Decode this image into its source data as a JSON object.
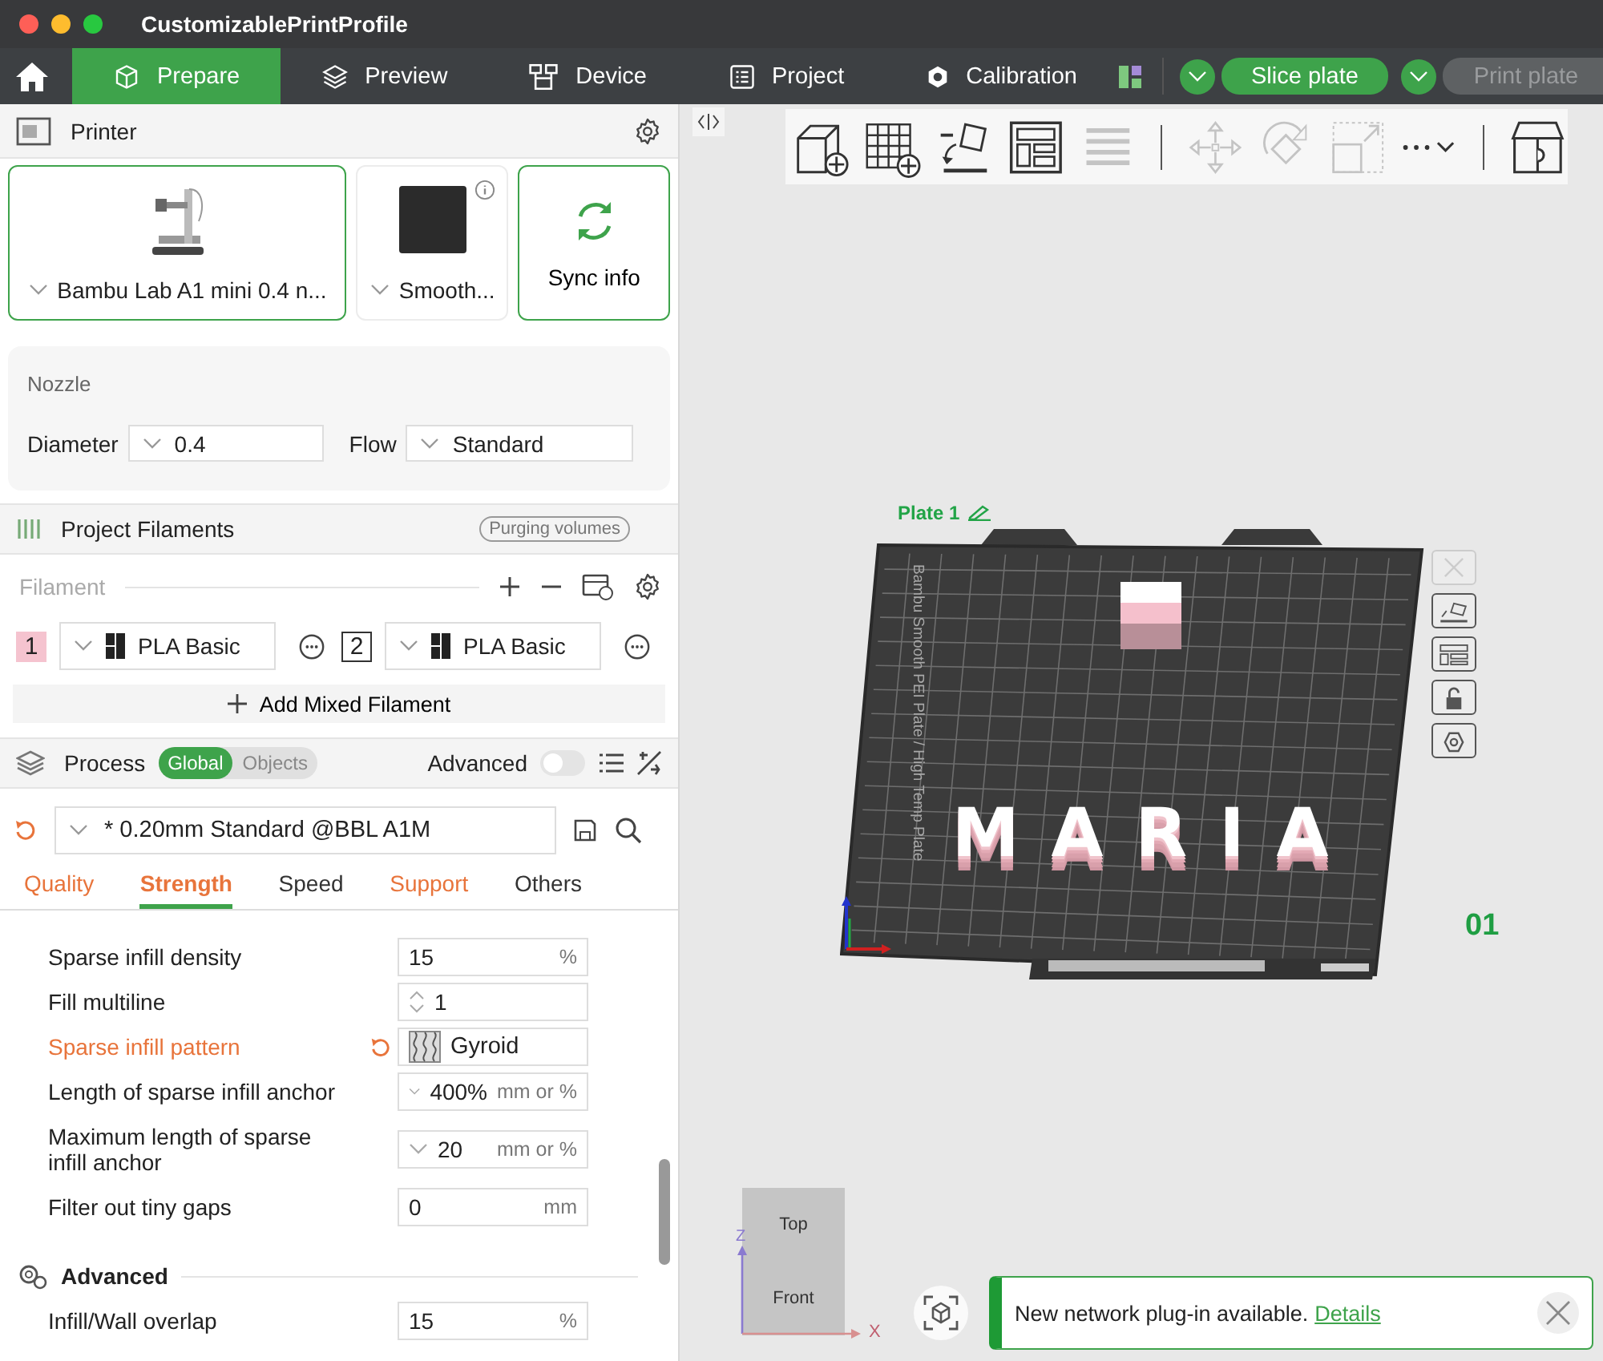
{
  "window": {
    "title": "CustomizablePrintProfile"
  },
  "toolbar": {
    "tabs": [
      {
        "label": "Prepare",
        "kind": "prepare",
        "selected": true
      },
      {
        "label": "Preview",
        "kind": "preview",
        "selected": false
      },
      {
        "label": "Device",
        "kind": "device",
        "selected": false
      },
      {
        "label": "Project",
        "kind": "project",
        "selected": false
      },
      {
        "label": "Calibration",
        "kind": "calibration",
        "selected": false
      }
    ],
    "slice_button": {
      "label": "Slice plate",
      "disabled": false
    },
    "print_button": {
      "label": "Print plate",
      "disabled": true
    }
  },
  "printer": {
    "title": "Printer",
    "printer_preset": {
      "label": "Bambu Lab A1 mini 0.4 n...",
      "selected": true
    },
    "plate_preset": {
      "label": "Smooth...",
      "selected": false
    },
    "sync_button": {
      "label": "Sync info"
    },
    "nozzle": {
      "title": "Nozzle",
      "diameter": {
        "label": "Diameter",
        "value": "0.4"
      },
      "flow": {
        "label": "Flow",
        "value": "Standard"
      }
    }
  },
  "filaments": {
    "title": "Project Filaments",
    "purge_button": "Purging volumes",
    "list_label": "Filament",
    "items": [
      {
        "index": "1",
        "name": "PLA Basic",
        "color": "#f5c3cf"
      },
      {
        "index": "2",
        "name": "PLA Basic",
        "color": "#ffffff"
      }
    ],
    "add_mixed": "Add Mixed Filament"
  },
  "process": {
    "title": "Process",
    "scope": [
      {
        "label": "Global",
        "selected": true
      },
      {
        "label": "Objects",
        "selected": false
      }
    ],
    "advanced": {
      "label": "Advanced",
      "on": false
    },
    "preset": "* 0.20mm Standard @BBL A1M",
    "preset_modified": true,
    "tabs": [
      {
        "label": "Quality",
        "selected": false,
        "modified": true
      },
      {
        "label": "Strength",
        "selected": true,
        "modified": true
      },
      {
        "label": "Speed",
        "selected": false,
        "modified": false
      },
      {
        "label": "Support",
        "selected": false,
        "modified": true
      },
      {
        "label": "Others",
        "selected": false,
        "modified": false
      }
    ],
    "settings": [
      {
        "kind": "number",
        "label": "Sparse infill density",
        "value": "15",
        "unit": "%",
        "modified": false
      },
      {
        "kind": "spin",
        "label": "Fill multiline",
        "value": "1",
        "modified": false
      },
      {
        "kind": "pattern",
        "label": "Sparse infill pattern",
        "value": "Gyroid",
        "modified": true
      },
      {
        "kind": "combo",
        "label": "Length of sparse infill anchor",
        "value": "400%",
        "unit": "mm or %",
        "modified": false
      },
      {
        "kind": "combo",
        "label": "Maximum length of sparse infill anchor",
        "value": "20",
        "unit": "mm or %",
        "modified": false
      },
      {
        "kind": "number",
        "label": "Filter out tiny gaps",
        "value": "0",
        "unit": "mm",
        "modified": false
      },
      {
        "kind": "group",
        "label": "Advanced"
      },
      {
        "kind": "number",
        "label": "Infill/Wall overlap",
        "value": "15",
        "unit": "%",
        "modified": false
      }
    ]
  },
  "viewport": {
    "tool_groups": [
      [
        {
          "kind": "add-model",
          "disabled": false
        },
        {
          "kind": "add-plate",
          "disabled": false
        },
        {
          "kind": "auto-orient",
          "disabled": false
        },
        {
          "kind": "arrange",
          "disabled": false
        },
        {
          "kind": "layers",
          "disabled": true
        }
      ],
      [
        {
          "kind": "move",
          "disabled": true
        },
        {
          "kind": "rotate",
          "disabled": true
        },
        {
          "kind": "scale",
          "disabled": true
        },
        {
          "kind": "more",
          "disabled": false
        }
      ],
      [
        {
          "kind": "assembly",
          "disabled": false
        }
      ]
    ],
    "plate": {
      "title": "Plate 1",
      "number": "01",
      "bed_label": "Bambu Smooth PEI Plate / High Temp Plate",
      "model_text": "MARIA"
    },
    "side_tools": [
      {
        "kind": "close",
        "disabled": true
      },
      {
        "kind": "orient",
        "disabled": false
      },
      {
        "kind": "arrange",
        "disabled": false
      },
      {
        "kind": "lock",
        "disabled": false
      },
      {
        "kind": "settings",
        "disabled": false
      }
    ],
    "view_cube": {
      "top": "Top",
      "front": "Front",
      "z_axis": "Z",
      "x_axis": "X"
    },
    "notification": {
      "message": "New network plug-in available.",
      "link": "Details"
    }
  }
}
